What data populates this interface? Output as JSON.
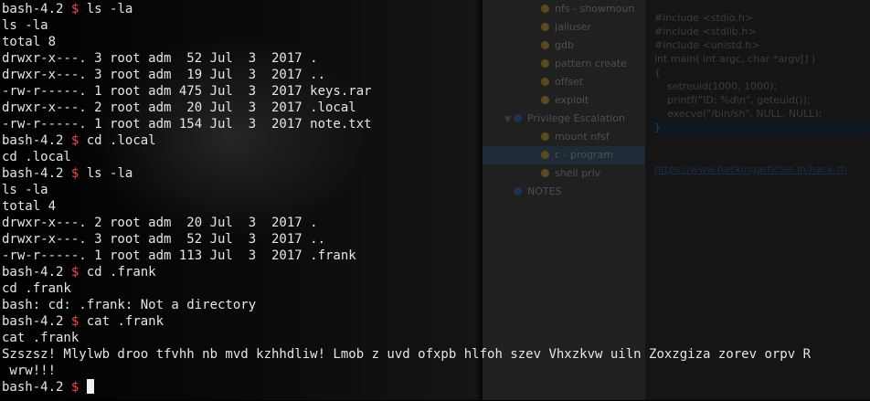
{
  "terminal": {
    "lines": [
      {
        "prompt": "bash-4.2",
        "command": "ls -la"
      },
      {
        "text": "ls -la"
      },
      {
        "text": "total 8"
      },
      {
        "text": "drwxr-x---. 3 root adm  52 Jul  3  2017 ."
      },
      {
        "text": "drwxr-x---. 3 root adm  19 Jul  3  2017 .."
      },
      {
        "text": "-rw-r-----. 1 root adm 475 Jul  3  2017 keys.rar"
      },
      {
        "text": "drwxr-x---. 2 root adm  20 Jul  3  2017 .local"
      },
      {
        "text": "-rw-r-----. 1 root adm 154 Jul  3  2017 note.txt"
      },
      {
        "prompt": "bash-4.2",
        "command": "cd .local"
      },
      {
        "text": "cd .local"
      },
      {
        "prompt": "bash-4.2",
        "command": "ls -la"
      },
      {
        "text": "ls -la"
      },
      {
        "text": "total 4"
      },
      {
        "text": "drwxr-x---. 2 root adm  20 Jul  3  2017 ."
      },
      {
        "text": "drwxr-x---. 3 root adm  52 Jul  3  2017 .."
      },
      {
        "text": "-rw-r-----. 1 root adm 113 Jul  3  2017 .frank"
      },
      {
        "prompt": "bash-4.2",
        "command": "cd .frank"
      },
      {
        "text": "cd .frank"
      },
      {
        "text": "bash: cd: .frank: Not a directory"
      },
      {
        "prompt": "bash-4.2",
        "command": "cat .frank"
      },
      {
        "text": "cat .frank"
      },
      {
        "text": "Szszsz! Mlylwb droo tfvhh nb mvd kzhhdliw! Lmob z uvd ofxpb hlfoh szev Vhxzkvw uiln Zoxzgiza zorev orpv R"
      },
      {
        "text": " wrw!!!"
      },
      {
        "prompt": "bash-4.2",
        "command": "",
        "cursor": true
      }
    ],
    "prompt_separator": "$"
  },
  "background_app": {
    "tree_items": [
      {
        "label": "nfs - showmoun",
        "icon": "note-icon"
      },
      {
        "label": "jailuser",
        "icon": "note-icon"
      },
      {
        "label": "gdb",
        "icon": "note-icon"
      },
      {
        "label": "pattern create",
        "icon": "note-icon"
      },
      {
        "label": "offset",
        "icon": "note-icon"
      },
      {
        "label": "exploit",
        "icon": "note-icon"
      },
      {
        "label": "Privilege Escalation",
        "icon": "folder-icon",
        "expanded": true
      },
      {
        "label": "mount nfsf",
        "icon": "note-icon"
      },
      {
        "label": "c - program",
        "icon": "note-icon",
        "selected": true
      },
      {
        "label": "shell priv",
        "icon": "note-icon"
      },
      {
        "label": "NOTES",
        "icon": "folder-icon"
      }
    ],
    "code_lines": [
      "#include <stdio.h>",
      "#include <stdlib.h>",
      "#include <unistd.h>",
      "int main( int argc, char *argv[] )",
      "{",
      "setreuid(1000, 1000);",
      "printf(\"ID: %d\\n\", geteuid());",
      "execve(\"/bin/sh\", NULL, NULL);",
      "}"
    ],
    "link": "https://www.hackingarticles.in/hack-th"
  },
  "colors": {
    "terminal_fg": "#e6e6e6",
    "prompt_dollar": "#ff4040",
    "background": "#000000"
  }
}
